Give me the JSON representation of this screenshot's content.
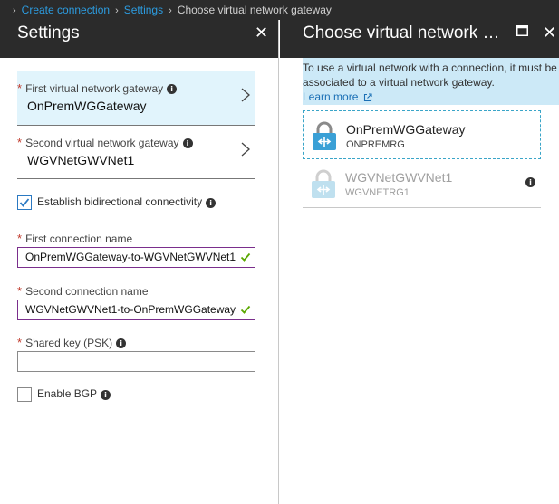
{
  "breadcrumb": {
    "items": [
      "Create connection",
      "Settings"
    ],
    "current": "Choose virtual network gateway"
  },
  "settings": {
    "title": "Settings",
    "close_icon": "close-icon",
    "first_gateway": {
      "label": "First virtual network gateway",
      "value": "OnPremWGGateway"
    },
    "second_gateway": {
      "label": "Second virtual network gateway",
      "value": "WGVNetGWVNet1"
    },
    "bidirectional": {
      "label": "Establish bidirectional connectivity",
      "checked": true
    },
    "first_connection": {
      "label": "First connection name",
      "value": "OnPremWGGateway-to-WGVNetGWVNet1"
    },
    "second_connection": {
      "label": "Second connection name",
      "value": "WGVNetGWVNet1-to-OnPremWGGateway"
    },
    "shared_key": {
      "label": "Shared key (PSK)",
      "value": ""
    },
    "bgp": {
      "label": "Enable BGP",
      "checked": false
    }
  },
  "chooser": {
    "title": "Choose virtual network gateway",
    "info_text": "To use a virtual network with a connection, it must be associated to a virtual network gateway.",
    "learn_more": "Learn more",
    "gateways": [
      {
        "name": "OnPremWGGateway",
        "resource_group": "ONPREMRG",
        "state": "selected"
      },
      {
        "name": "WGVNetGWVNet1",
        "resource_group": "WGVNETRG1",
        "state": "disabled"
      }
    ]
  },
  "colors": {
    "header_bg": "#2b2b2b",
    "link": "#2c9ce0",
    "selected_bg": "#e1f4fc",
    "info_bg": "#cce9f7",
    "valid_border": "#7a2e8c",
    "valid_check": "#5aa800",
    "required": "#c0392b"
  }
}
